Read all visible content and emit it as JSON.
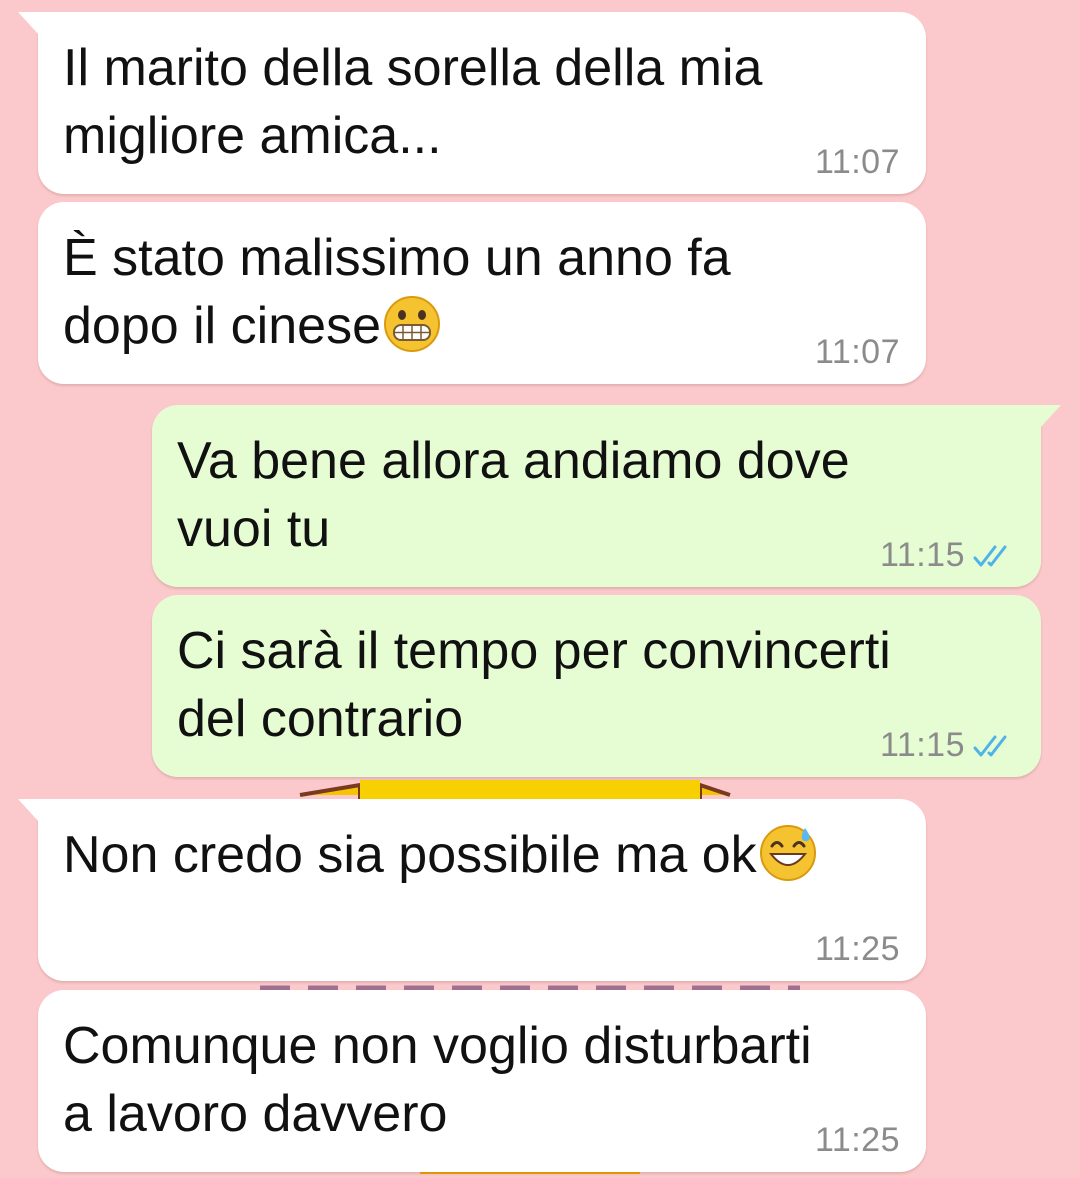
{
  "chat": {
    "messages": [
      {
        "direction": "in",
        "text": "Il marito della sorella della mia\nmigliore amica...",
        "time": "11:07"
      },
      {
        "direction": "in",
        "text": "È stato malissimo un anno fa\ndopo il cinese",
        "emoji": "grimacing-face",
        "time": "11:07"
      },
      {
        "direction": "out",
        "text": "Va bene allora andiamo dove\nvuoi tu",
        "time": "11:15",
        "status": "read"
      },
      {
        "direction": "out",
        "text": "Ci sarà  il tempo per convincerti\ndel contrario",
        "time": "11:15",
        "status": "read"
      },
      {
        "direction": "in",
        "text": "Non credo sia possibile ma ok",
        "emoji": "grinning-face-with-sweat",
        "time": "11:25"
      },
      {
        "direction": "in",
        "text": "Comunque non voglio disturbarti\na lavoro davvero",
        "time": "11:25"
      }
    ]
  },
  "colors": {
    "wallpaper": "#fbc9cb",
    "incoming_bubble": "#ffffff",
    "outgoing_bubble": "#e6fdd4",
    "time_text": "#8b8b8b",
    "read_ticks": "#4fb3e8"
  }
}
